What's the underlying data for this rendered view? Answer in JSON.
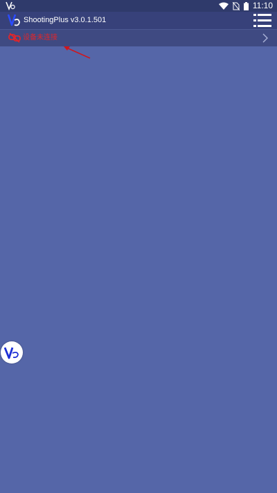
{
  "status_bar": {
    "time": "11:10",
    "icons": [
      "wifi-icon",
      "no-sim-icon",
      "battery-icon"
    ],
    "notification_icon": "vcs-logo-icon"
  },
  "app_bar": {
    "title": "ShootingPlus v3.0.1.501",
    "menu_icon": "menu-list-icon"
  },
  "connection": {
    "label": "设备未连接",
    "status_color": "#e0262b",
    "icon": "unlink-icon"
  },
  "floating_button": {
    "icon": "vcs-logo-icon"
  },
  "colors": {
    "background": "#5566a8",
    "status_bar": "#2f3a6b",
    "app_bar": "#37417a",
    "connection_row": "#3f4a82",
    "alert": "#e0262b"
  }
}
